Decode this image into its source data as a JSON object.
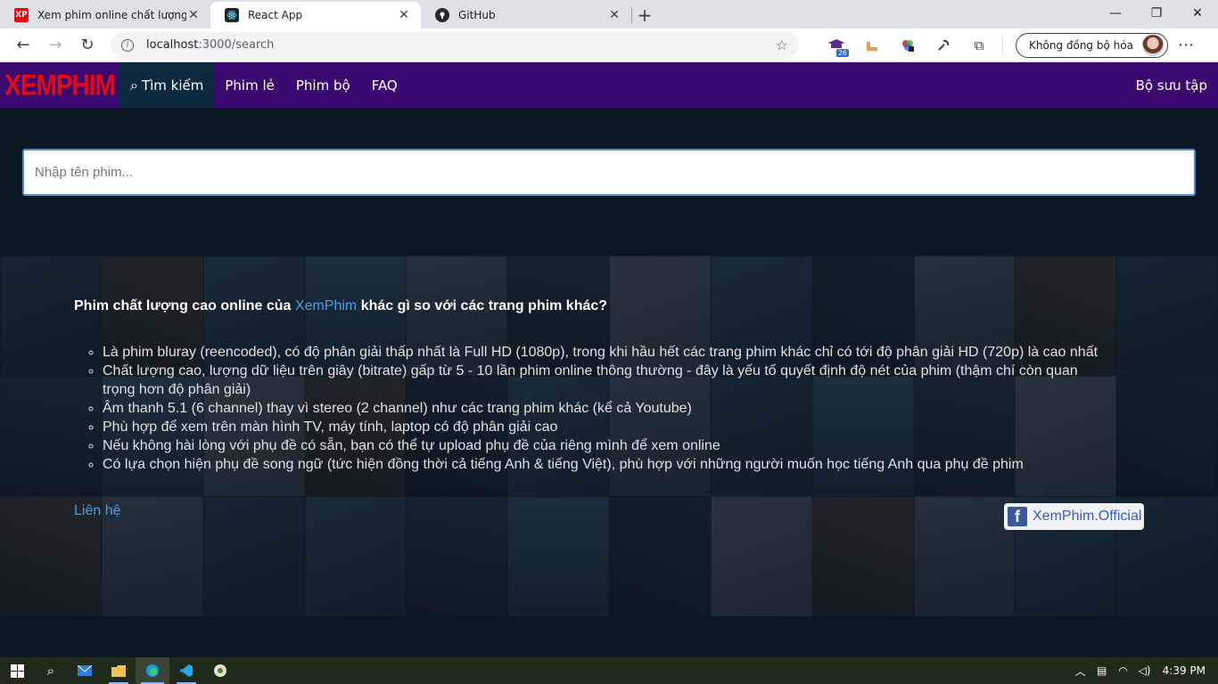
{
  "browser": {
    "tabs": [
      {
        "title": "Xem phim online chất lượng cao",
        "favicon": "XP",
        "active": false
      },
      {
        "title": "React App",
        "favicon": "react-icon",
        "active": true
      },
      {
        "title": "GitHub",
        "favicon": "github-icon",
        "active": false
      }
    ],
    "url_host": "localhost",
    "url_path": ":3000/search",
    "extension_badge": "26",
    "profile_label": "Không đồng bộ hóa"
  },
  "site": {
    "logo": "XEMPHIM",
    "nav": {
      "search": "Tìm kiếm",
      "movies": "Phim lẻ",
      "series": "Phim bộ",
      "faq": "FAQ",
      "collection": "Bộ sưu tập"
    },
    "search_placeholder": "Nhập tên phim...",
    "info": {
      "headline_pre": "Phim chất lượng cao online của ",
      "headline_brand": "XemPhim",
      "headline_post": " khác gì so với các trang phim khác?",
      "features": [
        "Là phim bluray (reencoded), có độ phân giải thấp nhất là Full HD (1080p), trong khi hầu hết các trang phim khác chỉ có tới độ phân giải HD (720p) là cao nhất",
        "Chất lượng cao, lượng dữ liệu trên giây (bitrate) gấp từ 5 - 10 lần phim online thông thường - đây là yếu tố quyết định độ nét của phim (thậm chí còn quan trọng hơn độ phân giải)",
        "Âm thanh 5.1 (6 channel) thay vì stereo (2 channel) như các trang phim khác (kể cả Youtube)",
        "Phù hợp để xem trên màn hình TV, máy tính, laptop có độ phân giải cao",
        "Nếu không hài lòng với phụ đề có sẵn, bạn có thể tự upload phụ đề của riêng mình để xem online",
        "Có lựa chọn hiện phụ đề song ngữ (tức hiện đồng thời cả tiếng Anh & tiếng Việt), phù hợp với những người muốn học tiếng Anh qua phụ đề phim"
      ],
      "contact": "Liên hệ",
      "facebook": "XemPhim.Official"
    }
  },
  "taskbar": {
    "time": "4:39 PM"
  },
  "colors": {
    "header_bg": "#3b0a70",
    "logo": "#e50914",
    "active_nav": "#0b2a40",
    "page_bg": "#0b1723",
    "link": "#4a9fe8"
  }
}
